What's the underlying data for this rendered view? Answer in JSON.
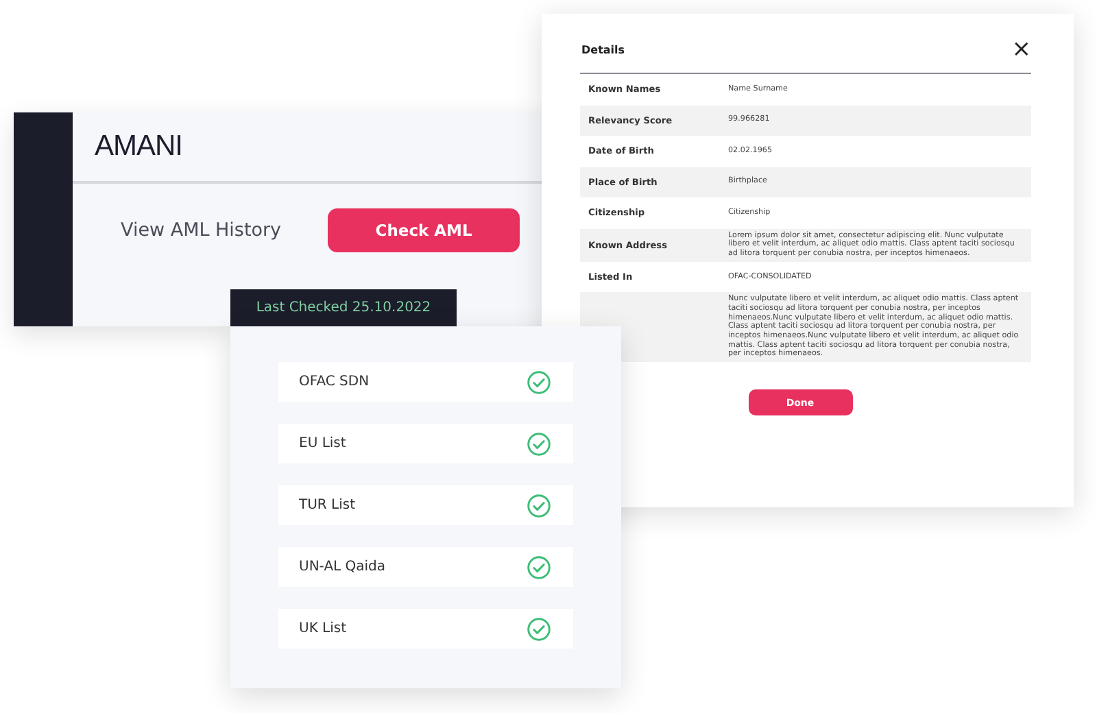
{
  "profile_card": {
    "logo": "AMANI",
    "history_link": "View AML History",
    "check_button": "Check AML",
    "last_checked": "Last Checked 25.10.2022"
  },
  "details": {
    "title": "Details",
    "close": "×",
    "rows": [
      {
        "label": "Known Names",
        "value": "Name Surname"
      },
      {
        "label": "Relevancy Score",
        "value": "99.966281"
      },
      {
        "label": "Date of Birth",
        "value": "02.02.1965"
      },
      {
        "label": "Place of Birth",
        "value": "Birthplace"
      },
      {
        "label": "Citizenship",
        "value": "Citizenship"
      },
      {
        "label": "Known Address",
        "value": "Lorem ipsum dolor sit amet, consectetur adipiscing elit. Nunc vulputate libero et velit interdum, ac aliquet odio mattis. Class aptent taciti sociosqu ad litora torquent per conubia nostra, per inceptos himenaeos."
      },
      {
        "label": "Listed In",
        "value": "OFAC-CONSOLIDATED"
      },
      {
        "value": "Nunc vulputate libero et velit interdum, ac aliquet odio mattis. Class aptent taciti sociosqu ad litora torquent per conubia nostra, per inceptos himenaeos.Nunc vulputate libero et velit interdum, ac aliquet odio mattis. Class aptent taciti sociosqu ad litora torquent per conubia nostra, per inceptos himenaeos.Nunc vulputate libero et velit interdum, ac aliquet odio mattis. Class aptent taciti sociosqu ad litora torquent per conubia nostra, per inceptos himenaeos."
      }
    ],
    "done_button": "Done"
  },
  "lists": [
    {
      "name": "OFAC SDN",
      "checked": true
    },
    {
      "name": "EU List",
      "checked": true
    },
    {
      "name": "TUR List",
      "checked": true
    },
    {
      "name": "UN-AL Qaida",
      "checked": true
    },
    {
      "name": "UK List",
      "checked": true
    }
  ]
}
